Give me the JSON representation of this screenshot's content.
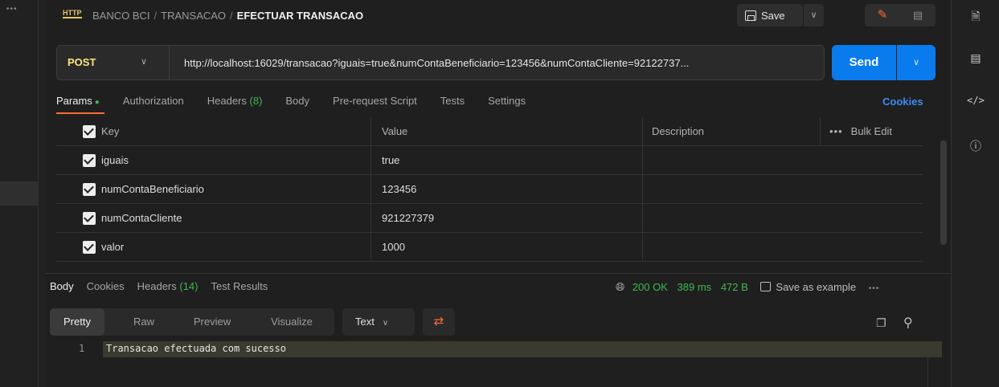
{
  "header": {
    "protocol_icon": "HTTP",
    "breadcrumb": [
      "BANCO BCI",
      "TRANSACAO"
    ],
    "separator": "/",
    "current": "EFECTUAR TRANSACAO",
    "save_label": "Save"
  },
  "request": {
    "method": "POST",
    "url": "http://localhost:16029/transacao?iguais=true&numContaBeneficiario=123456&numContaCliente=92122737...",
    "send_label": "Send"
  },
  "tabs": [
    {
      "label": "Params",
      "active": true,
      "dot": "●"
    },
    {
      "label": "Authorization"
    },
    {
      "label": "Headers",
      "count": "(8)"
    },
    {
      "label": "Body"
    },
    {
      "label": "Pre-request Script"
    },
    {
      "label": "Tests"
    },
    {
      "label": "Settings"
    }
  ],
  "cookies_label": "Cookies",
  "params": {
    "headers": {
      "key": "Key",
      "value": "Value",
      "description": "Description",
      "bulk_edit": "Bulk Edit",
      "bulk_dots": "•••"
    },
    "rows": [
      {
        "key": "iguais",
        "value": "true",
        "checked": true
      },
      {
        "key": "numContaBeneficiario",
        "value": "123456",
        "checked": true
      },
      {
        "key": "numContaCliente",
        "value": "921227379",
        "checked": true
      },
      {
        "key": "valor",
        "value": "1000",
        "checked": true
      }
    ]
  },
  "response": {
    "tabs": [
      {
        "label": "Body",
        "active": true
      },
      {
        "label": "Cookies"
      },
      {
        "label": "Headers",
        "count": "(14)"
      },
      {
        "label": "Test Results"
      }
    ],
    "status": "200 OK",
    "time": "389 ms",
    "size": "472 B",
    "save_example": "Save as example",
    "more": "•••",
    "views": [
      "Pretty",
      "Raw",
      "Preview",
      "Visualize"
    ],
    "active_view": "Pretty",
    "format": "Text",
    "lines": [
      {
        "n": "1",
        "text": "Transacao efectuada com sucesso"
      }
    ]
  },
  "left_rail": {
    "dots": "•••"
  },
  "colors": {
    "accent": "#ff6c37",
    "send": "#097bed",
    "method": "#ffe47e",
    "success": "#3fb950",
    "link": "#3d8cf0"
  }
}
